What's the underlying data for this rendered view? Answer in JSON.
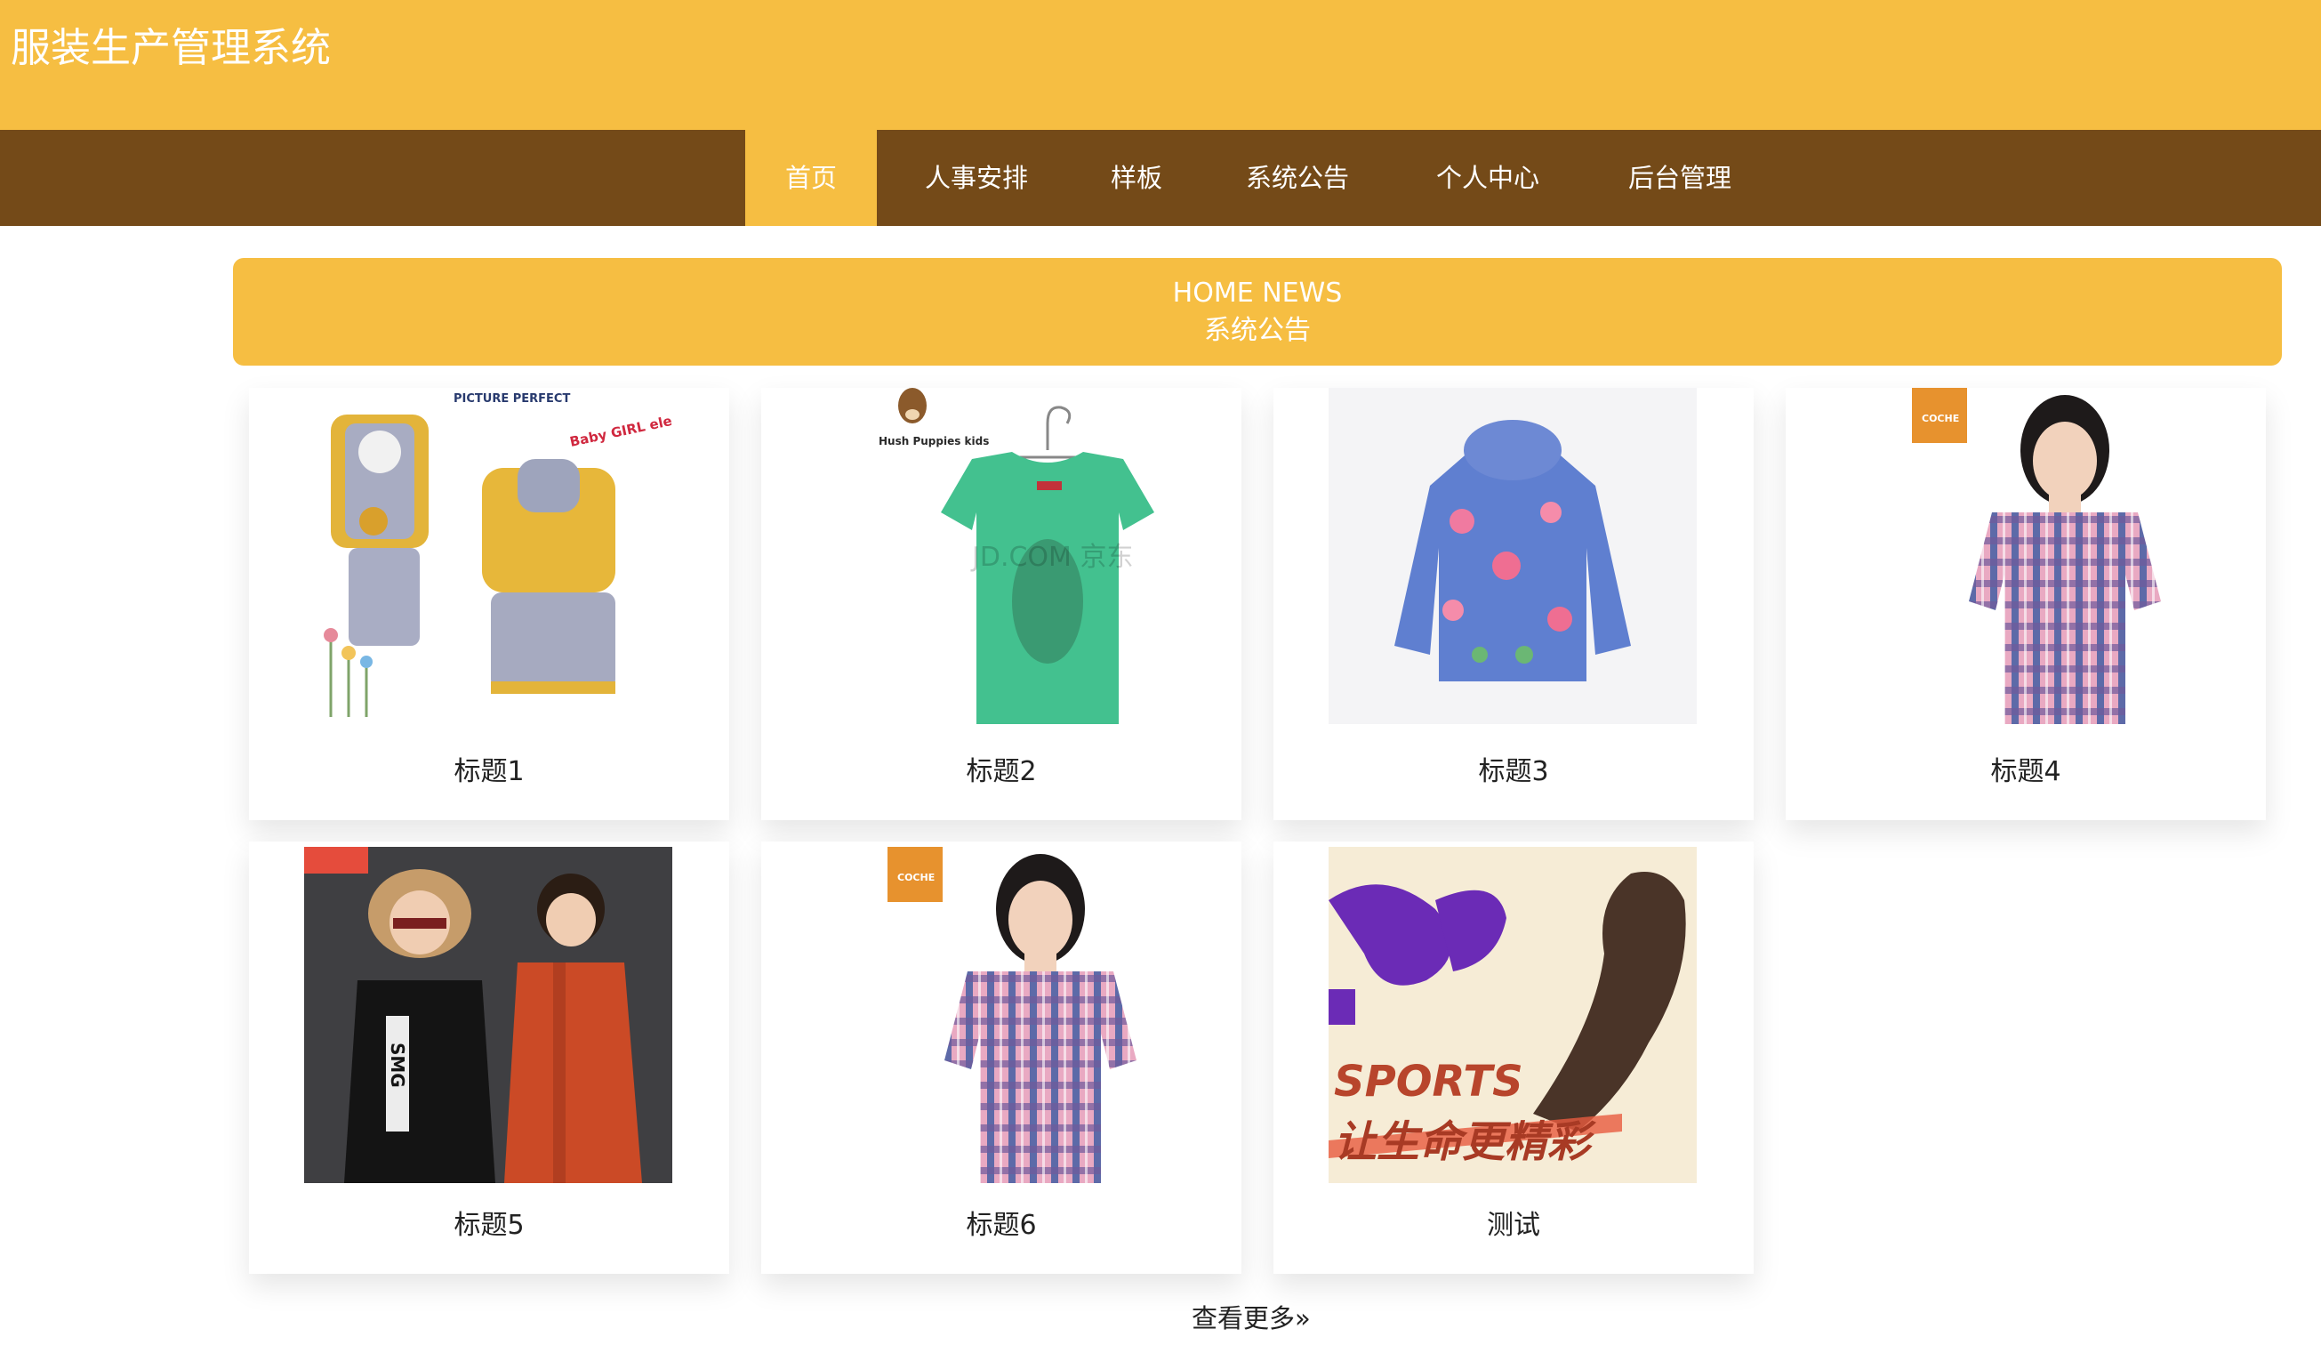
{
  "colors": {
    "brand": "#f6be42",
    "nav": "#744a18"
  },
  "header": {
    "title": "服装生产管理系统"
  },
  "nav": {
    "items": [
      {
        "label": "首页",
        "active": true
      },
      {
        "label": "人事安排",
        "active": false
      },
      {
        "label": "样板",
        "active": false
      },
      {
        "label": "系统公告",
        "active": false
      },
      {
        "label": "个人中心",
        "active": false
      },
      {
        "label": "后台管理",
        "active": false
      }
    ]
  },
  "news": {
    "heading_en": "HOME NEWS",
    "heading_cn": "系统公告"
  },
  "products": [
    {
      "title": "标题1",
      "image": "kids-yellow-tiger-outfit",
      "brand_text": "PICTURE PERFECT",
      "badge_text": "Baby GIRL elements"
    },
    {
      "title": "标题2",
      "image": "green-tshirt-on-hanger",
      "brand_text": "Hush Puppies kids",
      "watermark": "JD.COM 京东"
    },
    {
      "title": "标题3",
      "image": "floral-puffer-jacket"
    },
    {
      "title": "标题4",
      "image": "girl-plaid-shirt",
      "brand_text": "COCHE"
    },
    {
      "title": "标题5",
      "image": "kids-winter-coats",
      "jacket_text": "SMG"
    },
    {
      "title": "标题6",
      "image": "girl-plaid-shirt",
      "brand_text": "COCHE"
    },
    {
      "title": "测试",
      "image": "sports-poster",
      "poster_text": "SPORTS",
      "slogan": "让生命更精彩"
    }
  ],
  "more": {
    "label": "查看更多",
    "icon": "double-chevron-right-icon"
  }
}
